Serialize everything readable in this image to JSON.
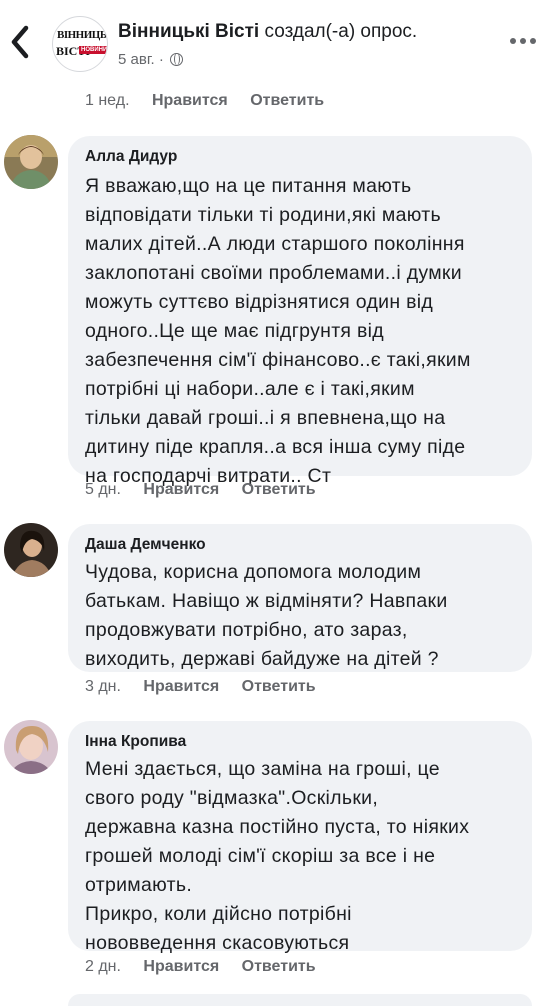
{
  "header": {
    "page_name": "Вінницькі Вісті",
    "action": "создал(-а) опрос.",
    "date": "5 авг.",
    "separator": "·",
    "logo": {
      "line1": "ВІННИЦЬКІ",
      "line2": "ВІСТІ",
      "tag": "НОВИНИ"
    }
  },
  "previous_comment": {
    "time": "1 нед.",
    "like_label": "Нравится",
    "reply_label": "Ответить"
  },
  "comments": [
    {
      "author": "Алла Дидур",
      "text": "Я вважаю,що на це питання мають\nвідповідати тільки ті родини,які мають\nмалих дітей..А люди старшого покоління\nзаклопотані своїми проблемами..і думки\nможуть суттєво відрізнятися один від\nодного..Це ще має підгрунтя від\nзабезпечення сім'ї фінансово..є такі,яким\nпотрібні ці набори..але є і такі,яким\nтільки давай гроші..і я впевнена,що на\nдитину піде крапля..а вся інша суму піде\nна господарчі витрати.. Ст",
      "time": "5 дн.",
      "like_label": "Нравится",
      "reply_label": "Ответить"
    },
    {
      "author": "Даша Демченко",
      "text": "Чудова, корисна допомога молодим\nбатькам. Навіщо ж відміняти? Навпаки\nпродовжувати потрібно, ато зараз,\nвиходить, державі байдуже на дітей ?",
      "time": "3 дн.",
      "like_label": "Нравится",
      "reply_label": "Ответить"
    },
    {
      "author": "Інна Кропива",
      "text": "Мені здається, що заміна на гроші, це\nсвого роду \"відмазка\".Оскільки,\nдержавна казна постійно пуста, то ніяких\nгрошей молоді сім'ї скоріш за все і не\nотримають.\nПрикро, коли дійсно потрібні\nнововведення скасовуються",
      "time": "2 дн.",
      "like_label": "Нравится",
      "reply_label": "Ответить"
    }
  ],
  "icons": [
    "back-icon",
    "globe-icon",
    "more-options-icon"
  ],
  "colors": {
    "bubble": "#f0f2f5",
    "secondary_text": "#65676b",
    "primary_text": "#1c1e21"
  }
}
